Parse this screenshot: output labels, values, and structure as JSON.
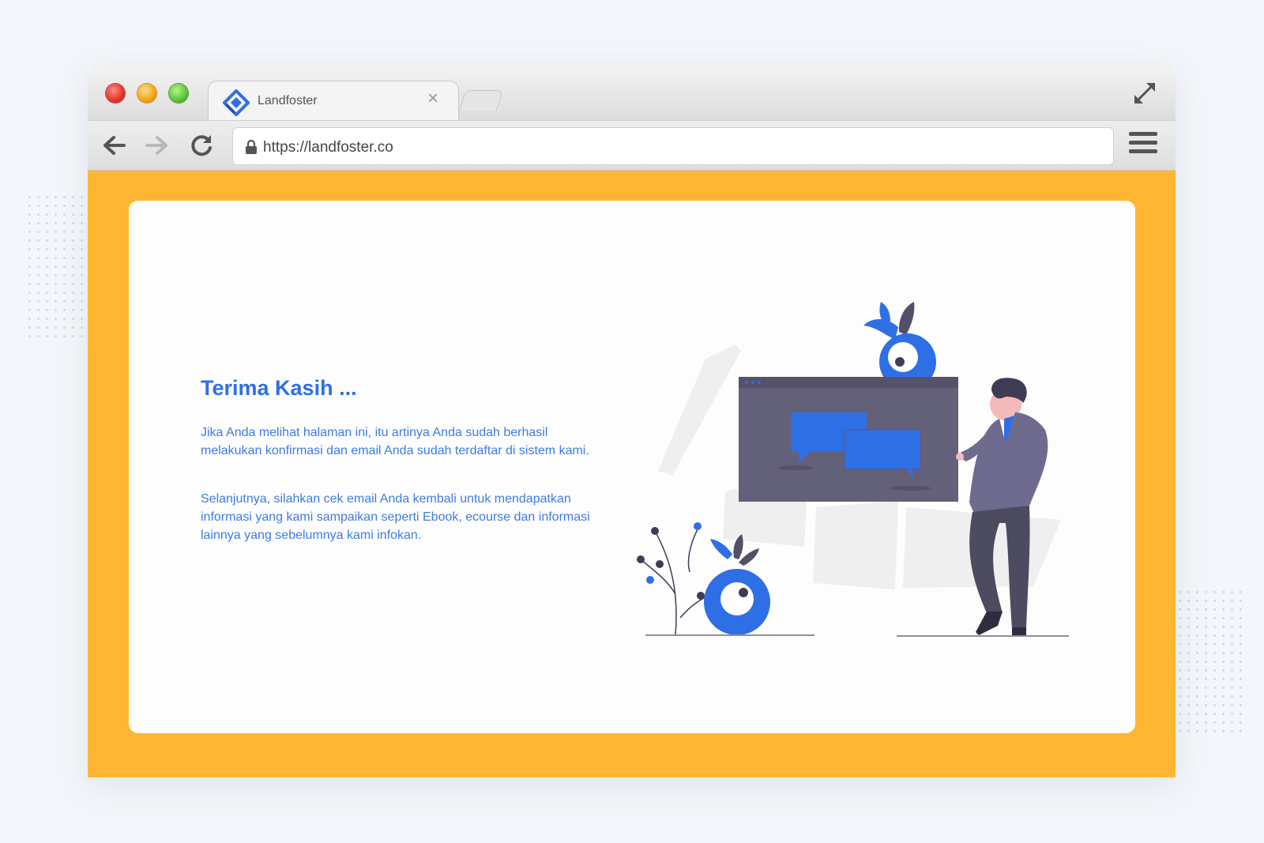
{
  "browser": {
    "tab": {
      "title": "Landfoster",
      "close_glyph": "×",
      "logo_icon": "landfoster-logo-icon"
    },
    "address_bar": {
      "url": "https://landfoster.co",
      "lock_icon": "lock-icon"
    },
    "nav_icons": [
      "back-arrow-icon",
      "forward-arrow-icon",
      "reload-icon"
    ],
    "menu_icon": "hamburger-menu-icon",
    "expand_icon": "fullscreen-expand-icon"
  },
  "page": {
    "heading": "Terima Kasih ...",
    "paragraph_1": "Jika Anda melihat halaman ini, itu artinya Anda sudah berhasil melakukan konfirmasi dan email Anda sudah terdaftar di sistem kami.",
    "paragraph_2": "Selanjutnya, silahkan cek email Anda kembali untuk mendapatkan informasi yang kami sampaikan seperti Ebook, ecourse dan informasi lainnya yang sebelumnya kami infokan."
  },
  "colors": {
    "accent": "#2f6fe6",
    "background_band": "#ffb733",
    "card": "#fdfdfd",
    "illustration_dark": "#63607a",
    "illustration_person": "#6e6b8f"
  }
}
